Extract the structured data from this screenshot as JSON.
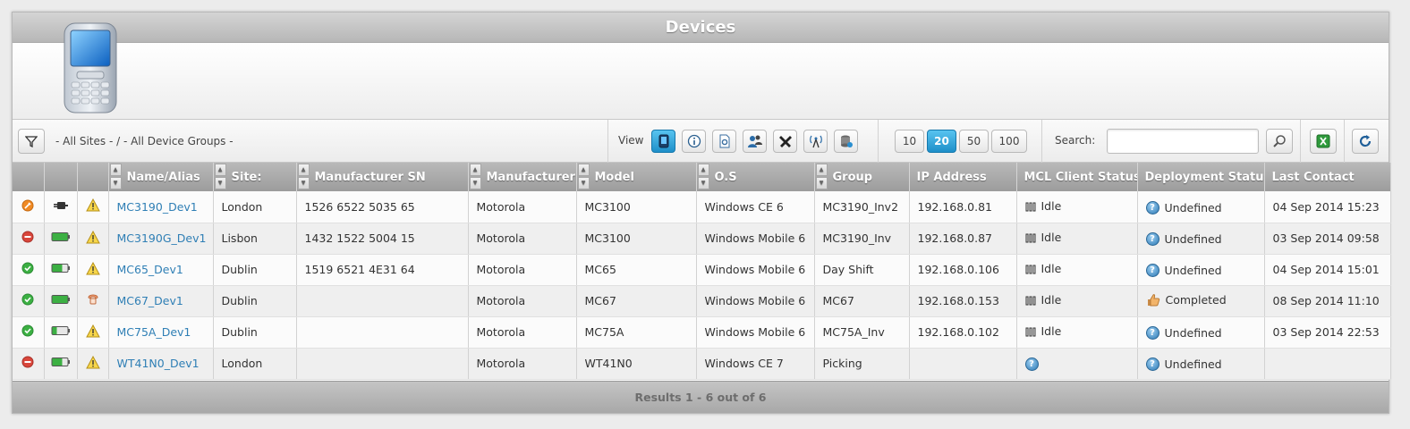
{
  "window": {
    "title": "Devices"
  },
  "toolbar": {
    "filter_text": "- All Sites - / - All Device Groups -",
    "view_label": "View",
    "page_sizes": [
      "10",
      "20",
      "50",
      "100"
    ],
    "active_page_size": "20",
    "search_label": "Search:",
    "search_value": ""
  },
  "table": {
    "columns": [
      "Name/Alias",
      "Site:",
      "Manufacturer SN",
      "Manufacturer",
      "Model",
      "O.S",
      "Group",
      "IP Address",
      "MCL Client Status",
      "Deployment Status",
      "Last Contact"
    ],
    "rows": [
      {
        "state": "orange",
        "battery": "plug",
        "alert": "warning",
        "name": "MC3190_Dev1",
        "site": "London",
        "sn": "1526 6522 5035 65",
        "manufacturer": "Motorola",
        "model": "MC3100",
        "os": "Windows CE 6",
        "group": "MC3190_Inv2",
        "ip": "192.168.0.81",
        "mcl": "Idle",
        "deploy_icon": "question",
        "deploy": "Undefined",
        "last": "04 Sep 2014 15:23"
      },
      {
        "state": "red",
        "battery": "full",
        "alert": "warning",
        "name": "MC3190G_Dev1",
        "site": "Lisbon",
        "sn": "1432 1522 5004 15",
        "manufacturer": "Motorola",
        "model": "MC3100",
        "os": "Windows Mobile 6",
        "group": "MC3190_Inv",
        "ip": "192.168.0.87",
        "mcl": "Idle",
        "deploy_icon": "question",
        "deploy": "Undefined",
        "last": "03 Sep 2014 09:58"
      },
      {
        "state": "green",
        "battery": "partial",
        "alert": "warning",
        "name": "MC65_Dev1",
        "site": "Dublin",
        "sn": "1519 6521 4E31 64",
        "manufacturer": "Motorola",
        "model": "MC65",
        "os": "Windows Mobile 6",
        "group": "Day Shift",
        "ip": "192.168.0.106",
        "mcl": "Idle",
        "deploy_icon": "question",
        "deploy": "Undefined",
        "last": "04 Sep 2014 15:01"
      },
      {
        "state": "green",
        "battery": "full",
        "alert": "phone",
        "name": "MC67_Dev1",
        "site": "Dublin",
        "sn": "",
        "manufacturer": "Motorola",
        "model": "MC67",
        "os": "Windows Mobile 6",
        "group": "MC67",
        "ip": "192.168.0.153",
        "mcl": "Idle",
        "deploy_icon": "thumb",
        "deploy": "Completed",
        "last": "08 Sep 2014 11:10"
      },
      {
        "state": "green",
        "battery": "low",
        "alert": "warning",
        "name": "MC75A_Dev1",
        "site": "Dublin",
        "sn": "",
        "manufacturer": "Motorola",
        "model": "MC75A",
        "os": "Windows Mobile 6",
        "group": "MC75A_Inv",
        "ip": "192.168.0.102",
        "mcl": "Idle",
        "deploy_icon": "question",
        "deploy": "Undefined",
        "last": "03 Sep 2014 22:53"
      },
      {
        "state": "red",
        "battery": "partial",
        "alert": "warning",
        "name": "WT41N0_Dev1",
        "site": "London",
        "sn": "",
        "manufacturer": "Motorola",
        "model": "WT41N0",
        "os": "Windows CE 7",
        "group": "Picking",
        "ip": "",
        "mcl": "",
        "mcl_icon": "question",
        "deploy_icon": "question",
        "deploy": "Undefined",
        "last": ""
      }
    ]
  },
  "footer": {
    "results": "Results 1 - 6 out of 6"
  },
  "colors": {
    "link": "#2f7fb5",
    "accent": "#1e8fc9",
    "ok": "#3cb043",
    "error": "#d9463b",
    "pending": "#f08a24"
  }
}
